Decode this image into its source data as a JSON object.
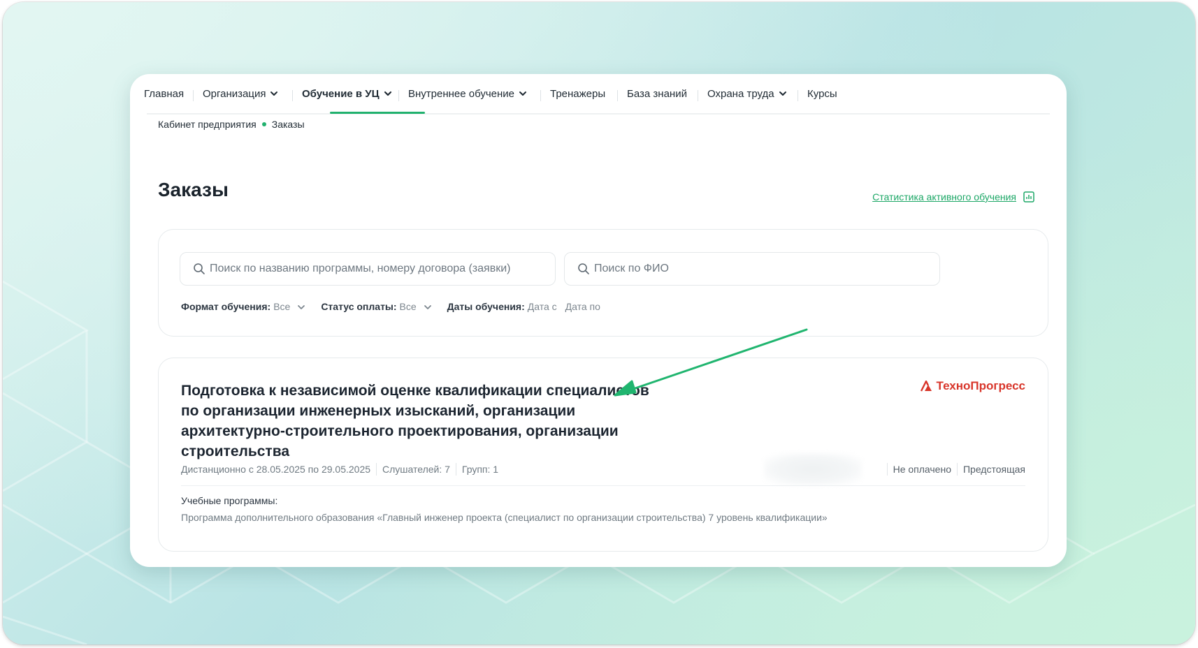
{
  "nav": {
    "items": [
      {
        "label": "Главная",
        "has_dropdown": false,
        "active": false
      },
      {
        "label": "Организация",
        "has_dropdown": true,
        "active": false
      },
      {
        "label": "Обучение в УЦ",
        "has_dropdown": true,
        "active": true
      },
      {
        "label": "Внутреннее обучение",
        "has_dropdown": true,
        "active": false
      },
      {
        "label": "Тренажеры",
        "has_dropdown": false,
        "active": false
      },
      {
        "label": "База знаний",
        "has_dropdown": false,
        "active": false
      },
      {
        "label": "Охрана труда",
        "has_dropdown": true,
        "active": false
      },
      {
        "label": "Курсы",
        "has_dropdown": false,
        "active": false
      }
    ]
  },
  "breadcrumbs": [
    "Кабинет предприятия",
    "Заказы"
  ],
  "page": {
    "title": "Заказы",
    "stats_link": "Статистика активного обучения"
  },
  "search": {
    "program_placeholder": "Поиск по названию программы, номеру договора (заявки)",
    "program_value": "",
    "fio_placeholder": "Поиск по ФИО",
    "fio_value": ""
  },
  "filters": {
    "format_label": "Формат обучения:",
    "format_value": "Все",
    "payment_label": "Статус оплаты:",
    "payment_value": "Все",
    "dates_label": "Даты обучения:",
    "date_from": "Дата с",
    "date_to": "Дата по"
  },
  "order": {
    "title": "Подготовка к независимой оценке квалификации специалистов по организации инженерных изысканий, организации архитектурно-строительного проектирования, организации строительства",
    "provider_logo": "ТехноПрогресс",
    "format_dates": "Дистанционно с 28.05.2025 по 29.05.2025",
    "listeners": "Слушателей: 7",
    "groups": "Групп: 1",
    "payment_status": "Не оплачено",
    "state": "Предстоящая",
    "programs_label": "Учебные программы:",
    "programs": [
      "Программа дополнительного образования «Главный инженер проекта (специалист по организации строительства) 7 уровень квалификации»"
    ]
  },
  "colors": {
    "accent": "#21b16e",
    "link": "#1ca766",
    "logo": "#d8352a",
    "arrow": "#20b56f"
  },
  "icons": [
    "chevron-down-icon",
    "search-icon",
    "bar-chart-icon",
    "logo-triangle-icon"
  ]
}
